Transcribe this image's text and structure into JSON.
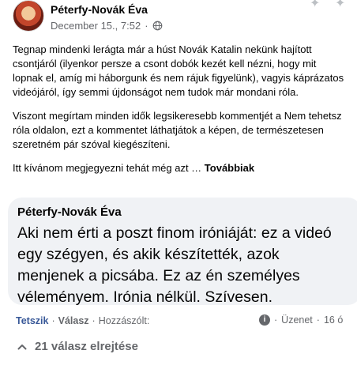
{
  "post": {
    "author": "Péterfy-Novák Éva",
    "date": "December 15., 7:52",
    "separator": "·",
    "paragraphs": [
      "Tegnap mindenki lerágta már a húst Novák Katalin nekünk hajított csontjáról (ilyenkor persze a csont dobók kezét kell nézni, hogy mit lopnak el, amíg mi háborgunk és nem rájuk figyelünk), vagyis káprázatos videójáról, így semmi újdonságot nem tudok már mondani róla.",
      "Viszont megírtam minden idők legsikeresebb kommentjét a Nem tehetsz róla oldalon, ezt a kommentet láthatjátok a képen, de természetesen szeretném pár szóval kiegészíteni."
    ],
    "teaser": "Itt kívánom megjegyezni tehát még azt …",
    "more_label": "Továbbiak"
  },
  "comment": {
    "author": "Péterfy-Novák Éva",
    "text": "Aki nem érti a poszt finom iróniáját: ez a videó egy szégyen, és akik készítették, azok menjenek a picsába. Ez az én személyes véleményem. Irónia nélkül. Szívesen."
  },
  "actions": {
    "like": "Tetszik",
    "reply": "Válasz",
    "share": "Hozzászólt:",
    "message": "Üzenet",
    "time": "16 ó"
  },
  "replies": {
    "label": "21 válasz elrejtése"
  },
  "icons": [
    "globe-icon",
    "info-icon",
    "chevron-up-icon"
  ]
}
